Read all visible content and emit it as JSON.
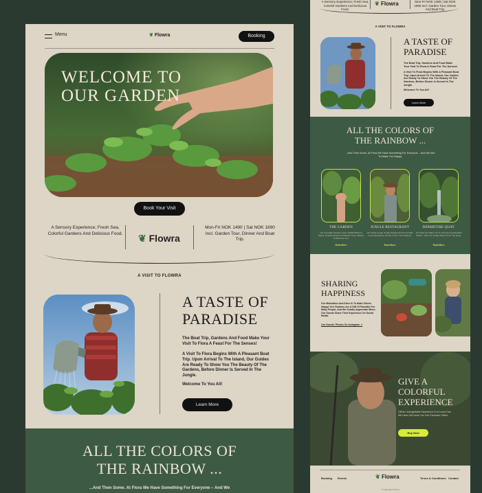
{
  "main": {
    "nav": {
      "menu_label": "Menu",
      "logo": "Flowra",
      "booking_label": "Booking"
    },
    "hero": {
      "title_line1": "WELCOME TO",
      "title_line2": "OUR GARDEN",
      "cta_label": "Book Your Visit"
    },
    "info": {
      "left_text": "A Sensory Experience; Fresh Sea, Colorful Gardens And Delicious Food.",
      "logo": "Flowra",
      "right_text": "Mon-Fri NOK 1490 | Sat NOK 1690 Incl. Garden Tour, Dinner And Boat Trip."
    },
    "taste": {
      "section_label": "A VISIT TO FLOWRA",
      "title_line1": "A TASTE OF",
      "title_line2": "PARADISE",
      "p1": "The Boat Trip, Gardens And Food Make Your Visit To Flora A Feast For The Senses!",
      "p2": "A Visit To Flora Begins With A Pleasant Boat Trip. Upon Arrival To The Island, Our Guides Are Ready To Show You The Beauty Of The Gardens, Before Dinner Is Served In The Jungle.",
      "p3": "Welcome To You All!",
      "cta_label": "Learn More"
    },
    "rainbow": {
      "title_line1": "ALL THE COLORS OF",
      "title_line2": "THE RAINBOW ...",
      "subtitle": "...And Then Some. At Flora We Have Something For Everyone – And We"
    }
  },
  "side": {
    "top": {
      "left_text": "A Sensory Experience; Fresh Sea, Colorful Gardens And Delicious Food.",
      "logo": "Flowra",
      "right_text": "Mon-Fri NOK 1490 | Sat NOK 1690 Incl. Garden Tour, Dinner And Boat Trip."
    },
    "taste": {
      "section_label": "A VISIT TO FLOWRA",
      "title_line1": "A TASTE OF",
      "title_line2": "PARADISE",
      "p1": "The Boat Trip, Gardens And Food Make Your Visit To Flora A Feast For The Senses!",
      "p2": "A Visit To Flora Begins With A Pleasant Boat Trip. Upon Arrival To The Island, Our Guides Are Ready To Show You The Beauty Of The Gardens, Before Dinner Is Served In The Jungle.",
      "p3": "Welcome To You All!",
      "cta_label": "Learn More"
    },
    "rainbow": {
      "title_line1": "ALL THE COLORS OF",
      "title_line2": "THE RAINBOW ...",
      "subtitle": "...And Then Some. At Flora We Have Something For Everyone – And We Aim To Make You Happy.",
      "cards": [
        {
          "title": "THE GARDEN",
          "text": "Our Incredible Gardens Have 10,000 Different Plants, Colorful Flowers And Exotic Trees. Beauty To Welcome You.",
          "link": "Read More"
        },
        {
          "title": "JUNGLE RESTAURANT",
          "text": "Our Chefs Create Jungle Restaurant Dinners With Local Ingredients, Served In Our Lush Gardens.",
          "link": "Read More"
        },
        {
          "title": "DEPARTURE QUAY",
          "text": "The Boat Trip Takes You To Flora Across Beautiful Waters. Then Our Guides Meet You At The Quay.",
          "link": "Read More"
        }
      ]
    },
    "share": {
      "title_line1": "SHARING",
      "title_line2": "HAPPINESS",
      "text": "Our Motivation And Drive Is To Make Others Happy! Our Gardens Are A Gift Of Paradise For Many People, And We Greatly Appreciate When Our Guests Share Their Experience On Social Media.",
      "link": "Our Guests' Photos On Instagram ↗"
    },
    "gift": {
      "title_line1": "GIVE A",
      "title_line2": "COLORFUL",
      "title_line3": "EXPERIENCE",
      "text": "Gift An Unforgettable Experience To A Loved One. We Have Gift Cards You Can Purchase Online.",
      "cta_label": "Buy Now"
    },
    "footer": {
      "booking": "Booking",
      "events": "Events",
      "logo": "Flowra",
      "terms": "Terms & Conditions",
      "contact": "Contact",
      "copyright": "© Copyright Flowra"
    }
  },
  "colors": {
    "page_bg": "#2b3a30",
    "cream": "#ddd5c5",
    "forest": "#3d5a44",
    "accent_lime": "#d6ea3f",
    "button": "#111111"
  },
  "icons": [
    "menu-icon",
    "leaf-logo-icon"
  ]
}
